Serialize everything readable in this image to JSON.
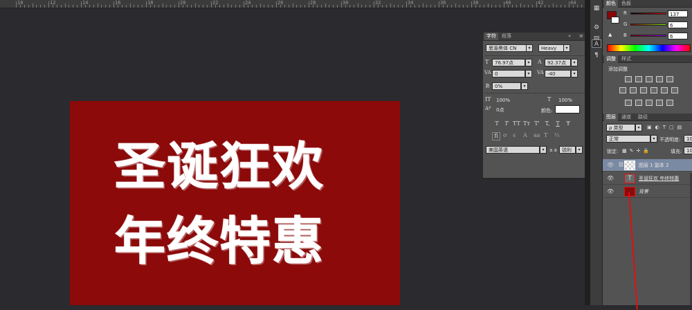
{
  "ruler": {
    "labels": [
      "10",
      "12",
      "14",
      "16",
      "18",
      "20",
      "22",
      "24",
      "26",
      "28",
      "30",
      "32",
      "34",
      "36",
      "38",
      "40",
      "42",
      "44"
    ]
  },
  "document": {
    "line1": "圣诞狂欢",
    "line2": "年终特惠",
    "bg_color": "#8c0a0a"
  },
  "panels": {
    "top_tabs": [
      "颜色",
      "色板"
    ],
    "color": {
      "r_label": "R",
      "r_value": "137",
      "g_label": "G",
      "g_value": "6",
      "b_label": "B",
      "b_value": "6",
      "foreground": "#890606"
    },
    "adjust_tabs": [
      "调整",
      "样式"
    ],
    "adjust_title": "添加调整",
    "layers_tabs": [
      "图层",
      "通道",
      "路径"
    ],
    "kind_label": "ρ 类型",
    "blend_mode": "正常",
    "opacity_label": "不透明度:",
    "opacity_value": "100",
    "lock_label": "锁定:",
    "fill_label": "填充:",
    "fill_value": "100",
    "layers": [
      {
        "name": "图层 1 副本 2",
        "type": "image"
      },
      {
        "name": "圣诞狂欢 年终特惠",
        "type": "text"
      },
      {
        "name": "背景",
        "type": "background"
      }
    ]
  },
  "character_panel": {
    "tabs": [
      "字符",
      "段落"
    ],
    "font_family": "思源黑体 CN",
    "font_style": "Heavy",
    "font_size": "76.97点",
    "leading": "92.37点",
    "kerning": "0",
    "tracking": "-40",
    "baseline_scale": "0%",
    "vertical_scale": "100%",
    "horizontal_scale": "100%",
    "baseline_shift": "0点",
    "color_label": "颜色:",
    "language": "美国英语",
    "aa_label": "a a",
    "anti_alias": "锐利",
    "type_buttons": [
      "T",
      "T",
      "TT",
      "Tт",
      "T'",
      "T,",
      "T",
      "Ŧ"
    ]
  }
}
